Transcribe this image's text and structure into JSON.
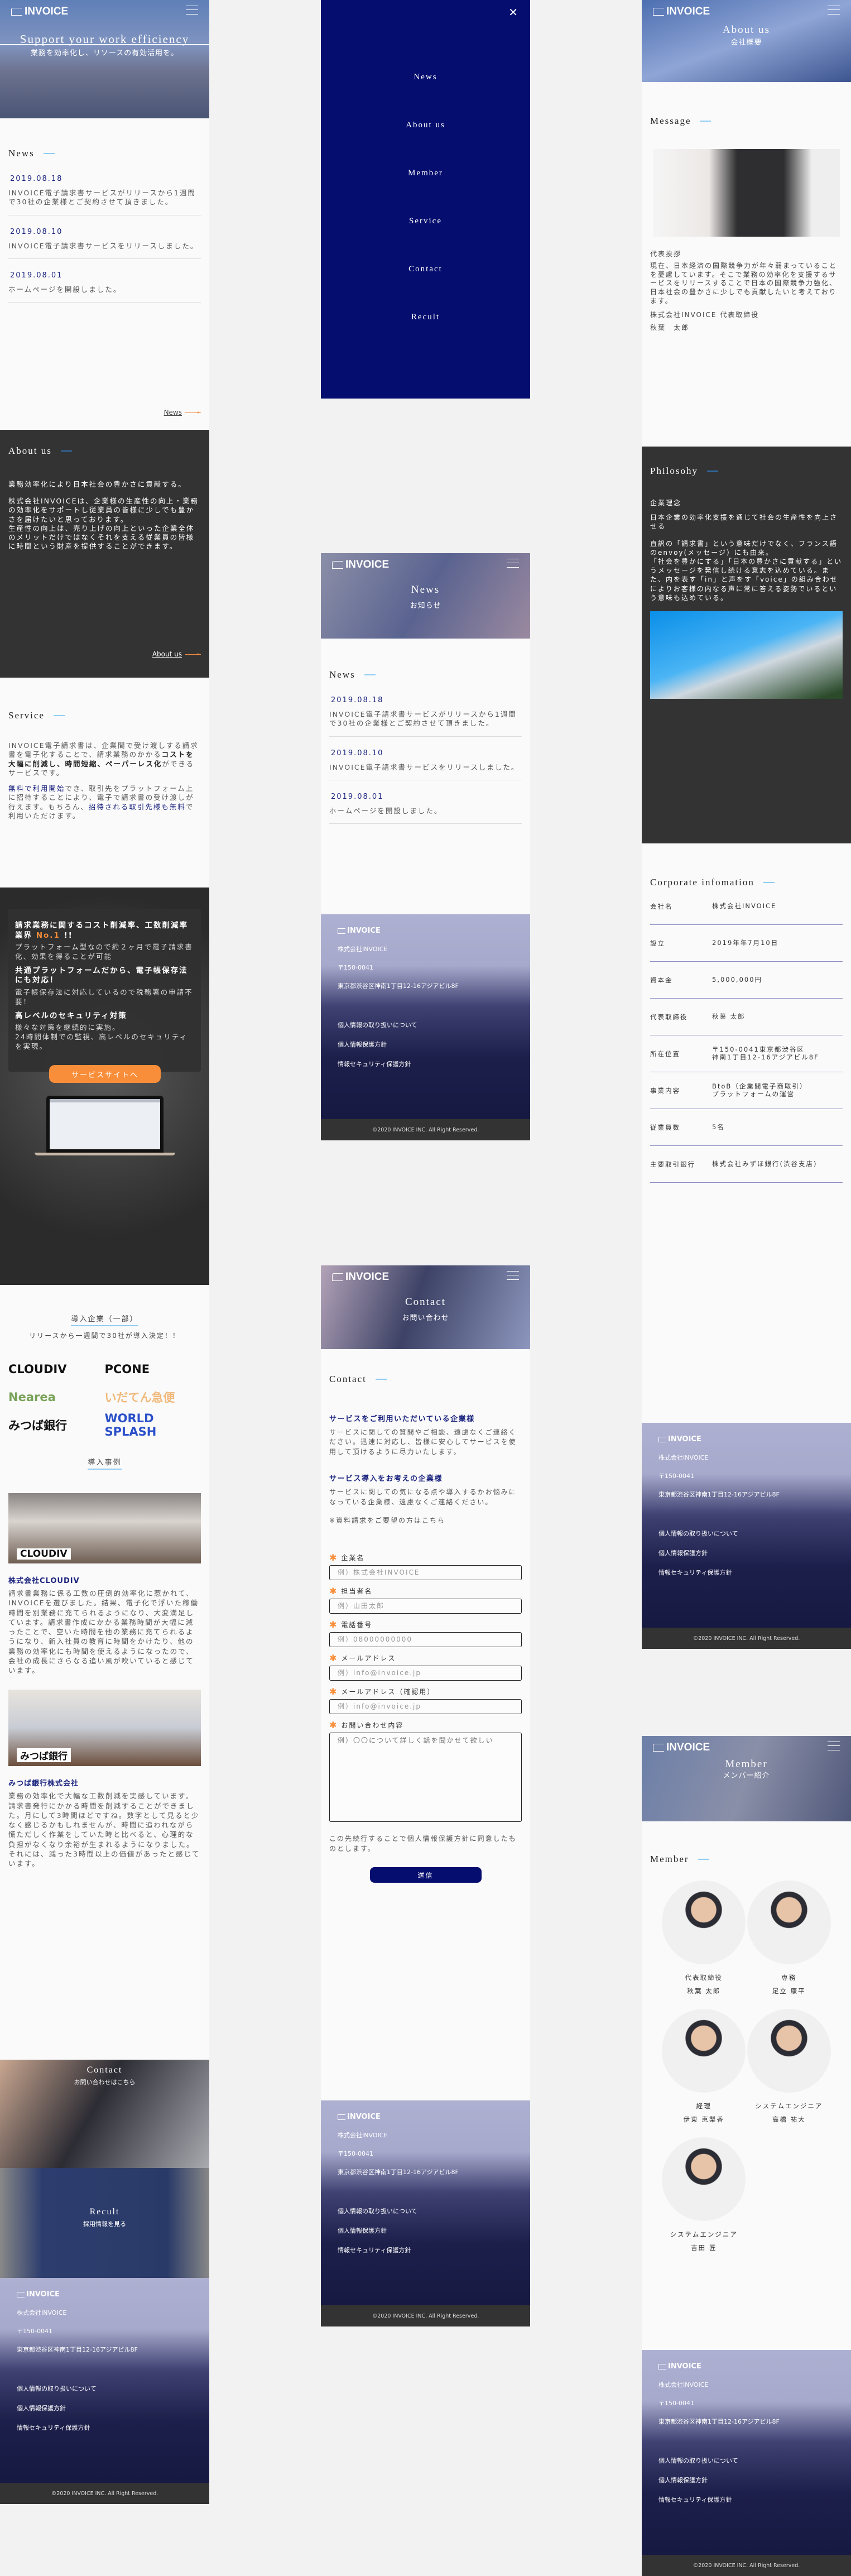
{
  "brand": "INVOICE",
  "colors": {
    "navy": "#050d6e",
    "accent_orange": "#f98e3a",
    "accent_lightblue": "#8ecdf5",
    "dark_bg": "#333333"
  },
  "footer": {
    "company": "株式会社INVOICE",
    "zip": "〒150-0041",
    "address": "東京都渋谷区神南1丁目12-16アジアビル8F",
    "links": [
      "個人情報の取り扱いについて",
      "個人情報保護方針",
      "情報セキュリティ保護方針"
    ],
    "copyright": "©2020 INVOICE INC. All Right Reserved."
  },
  "home": {
    "hero": {
      "title": "Support your work efficiency",
      "subtitle": "業務を効率化し、リソースの有効活用を。"
    },
    "news": {
      "title": "News",
      "items": [
        {
          "date": "2019.08.18",
          "text": "INVOICE電子請求書サービスがリリースから1週間で30社の企業様とご契約させて頂きました。"
        },
        {
          "date": "2019.08.10",
          "text": "INVOICE電子請求書サービスをリリースしました。"
        },
        {
          "date": "2019.08.01",
          "text": "ホームページを開設しました。"
        }
      ],
      "more": "News"
    },
    "about": {
      "title": "About us",
      "lead": "業務効率化により日本社会の豊かさに貢献する。",
      "body": "株式会社INVOICEは、企業様の生産性の向上・業務の効率化をサポートし従業員の皆様に少しでも豊かさを届けたいと思っております。\n生産性の向上は、売り上げの向上といった企業全体のメリットだけではなくそれを支える従業員の皆様に時間という財産を提供することができます。",
      "more": "About us"
    },
    "service": {
      "title": "Service",
      "p1_a": "INVOICE電子請求書は、企業間で受け渡しする請求書を電子化することで、請求業務のかかる",
      "p1_bold": "コストを大幅に削減し、時間短縮、ペーパーレス化",
      "p1_b": "ができるサービスです。",
      "p2_link1": "無料で利用開始",
      "p2_a": "でき、取引先をプラットフォーム上に招待することにより、電子で請求書の受け渡しが行えます。もちろん、",
      "p2_link2": "招待される取引先様も無料",
      "p2_b": "で利用いただけます。",
      "features": [
        {
          "title": "請求業務に関するコスト削減率、工数削減率　業界 ",
          "highlight": "No.1",
          "suffix": " !!",
          "text": "プラットフォーム型なので約２ヶ月で電子請求書化、効果を得ることが可能"
        },
        {
          "title": "共通プラットフォームだから、電子帳保存法にも対応！",
          "text": "電子帳保存法に対応しているので税務署の申請不要！"
        },
        {
          "title": "高レベルのセキュリティ対策",
          "text": "様々な対策を継続的に実施。\n24時間体制での監視、高レベルのセキュリティを実現。"
        }
      ],
      "button": "サービスサイトへ"
    },
    "clients": {
      "title": "導入企業（一部）",
      "subtitle": "リリースから一週間で30社が導入決定！！",
      "logos": [
        {
          "name": "CLOUDIV",
          "color": "#111111"
        },
        {
          "name": "PCONE",
          "color": "#111111"
        },
        {
          "name": "Nearea",
          "color": "#7aa35a"
        },
        {
          "name": "いだてん急便",
          "color": "#f0b87a"
        },
        {
          "name": "みつば銀行",
          "color": "#111111"
        },
        {
          "name": "WORLD SPLASH",
          "color": "#2a4fc9"
        }
      ]
    },
    "cases": {
      "title": "導入事例",
      "items": [
        {
          "logo": "CLOUDIV",
          "name": "株式会社CLOUDIV",
          "text": "請求書業務に係る工数の圧倒的効率化に惹かれて、INVOICEを選びました。結果、電子化で浮いた稼働時間を別業務に充てられるようになり、大変満足しています。請求書作成にかかる業務時間が大幅に減ったことで、空いた時間を他の業務に充てられるようになり、新入社員の教育に時間をかけたり、他の業務の効率化にも時間を使えるようになったので、会社の成長にさらなる追い風が吹いていると感じています。"
        },
        {
          "logo": "みつば銀行",
          "name": "みつば銀行株式会社",
          "text": "業務の効率化で大幅な工数削減を実感しています。請求書発行にかかる時間を削減することができました。月にして3時間ほどですね。数字として見ると少なく感じるかもしれませんが、時間に追われながら慌ただしく作業をしていた時と比べると、心理的な負担がなくなり余裕が生まれるようになりました。それには、減った3時間以上の価値があったと感じています。"
        }
      ]
    },
    "contact_banner": {
      "title": "Contact",
      "sub": "お問い合わせはこちら"
    },
    "recruit_banner": {
      "title": "Recult",
      "sub": "採用情報を見る"
    }
  },
  "menu": {
    "items": [
      "News",
      "About us",
      "Member",
      "Service",
      "Contact",
      "Recult"
    ]
  },
  "news_page": {
    "hero": {
      "title": "News",
      "sub": "お知らせ"
    }
  },
  "contact_page": {
    "hero": {
      "title": "Contact",
      "sub": "お問い合わせ"
    },
    "title": "Contact",
    "groups": [
      {
        "heading": "サービスをご利用いただいている企業様",
        "text": "サービスに関しての質問やご相談、遠慮なくご連絡ください。迅速に対応し、皆様に安心してサービスを使用して頂けるように尽力いたします。"
      },
      {
        "heading": "サービス導入をお考えの企業様",
        "text": "サービスに関しての気になる点や導入するかお悩みになっている企業様、遠慮なくご連絡ください。"
      }
    ],
    "note": "※資料請求をご要望の方はこちら",
    "fields": [
      {
        "label": "企業名",
        "placeholder": "例）株式会社INVOICE"
      },
      {
        "label": "担当者名",
        "placeholder": "例）山田太郎"
      },
      {
        "label": "電話番号",
        "placeholder": "例）08000000000"
      },
      {
        "label": "メールアドレス",
        "placeholder": "例）info@invoice.jp"
      },
      {
        "label": "メールアドレス（確認用）",
        "placeholder": "例）info@invoice.jp"
      }
    ],
    "message": {
      "label": "お問い合わせ内容",
      "placeholder": "例）〇〇について詳しく話を聞かせて欲しい"
    },
    "consent": "この先続行することで個人情報保護方針に同意したものとします。",
    "submit": "送信"
  },
  "about_page": {
    "hero": {
      "title": "About us",
      "sub": "会社概要"
    },
    "message": {
      "title": "Message",
      "heading": "代表挨拶",
      "text": "現在、日本経済の国際競争力が年々弱まっていることを憂慮しています。そこで業務の効率化を支援するサービスをリリースすることで日本の国際競争力強化、日本社会の豊かさに少しでも貢献したいと考えております。",
      "signature": "株式会社INVOICE 代表取締役",
      "name": "秋葉　太郎"
    },
    "philosophy": {
      "title": "Philosohy",
      "heading": "企業理念",
      "lead": "日本企業の効率化支援を通じて社会の生産性を向上させる",
      "text": "直訳の「請求書」という意味だけでなく、フランス語のenvoy(メッセージ）にも由来。\n「社会を豊かにする」「日本の豊かさに貢献する」というメッセージを発信し続ける意志を込めている。また、内を表す「in」と声をす「voice」の組み合わせによりお客様の内なる声に常に答える姿勢でいるという意味も込めている。"
    },
    "corporate": {
      "title": "Corporate infomation",
      "rows": [
        {
          "label": "会社名",
          "value": "株式会社INVOICE"
        },
        {
          "label": "設立",
          "value": "2019年年7月10日"
        },
        {
          "label": "資本金",
          "value": "5,000,000円"
        },
        {
          "label": "代表取締役",
          "value": "秋葉 太郎"
        },
        {
          "label": "所在位置",
          "value": "〒150-0041東京都渋谷区\n神南1丁目12-16アジアビル8F"
        },
        {
          "label": "事業内容",
          "value": "BtoB（企業間電子商取引）\nプラットフォームの運営"
        },
        {
          "label": "従業員数",
          "value": "5名"
        },
        {
          "label": "主要取引銀行",
          "value": "株式会社みずほ銀行(渋谷支店)"
        }
      ]
    }
  },
  "member_page": {
    "hero": {
      "title": "Member",
      "sub": "メンバー紹介"
    },
    "title": "Member",
    "members": [
      {
        "role": "代表取締役",
        "name": "秋葉 太郎"
      },
      {
        "role": "専務",
        "name": "足立 康平"
      },
      {
        "role": "経理",
        "name": "伊東 恵梨香"
      },
      {
        "role": "システムエンジニア",
        "name": "高橋 祐大"
      },
      {
        "role": "システムエンジニア",
        "name": "吉田 匠"
      }
    ]
  }
}
